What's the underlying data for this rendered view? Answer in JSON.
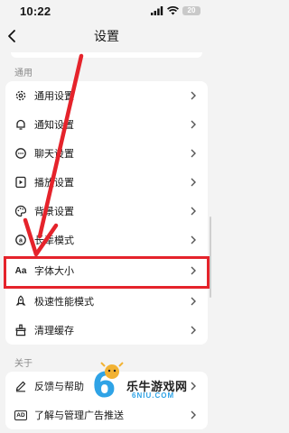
{
  "status_bar": {
    "time": "10:22",
    "battery": "20"
  },
  "header": {
    "title": "设置"
  },
  "sections": [
    {
      "label": "通用",
      "items": [
        {
          "label": "通用设置",
          "icon": "gear-icon"
        },
        {
          "label": "通知设置",
          "icon": "bell-icon"
        },
        {
          "label": "聊天设置",
          "icon": "chat-bubble-icon"
        },
        {
          "label": "播放设置",
          "icon": "play-icon"
        },
        {
          "label": "背景设置",
          "icon": "palette-icon"
        },
        {
          "label": "长辈模式",
          "icon": "elder-mode-icon"
        },
        {
          "label": "字体大小",
          "icon": "font-size-icon",
          "icon_text": "Aa"
        },
        {
          "label": "极速性能模式",
          "icon": "rocket-icon"
        },
        {
          "label": "清理缓存",
          "icon": "broom-icon"
        }
      ]
    },
    {
      "label": "关于",
      "items": [
        {
          "label": "反馈与帮助",
          "icon": "edit-icon"
        },
        {
          "label": "了解与管理广告推送",
          "icon": "ad-icon",
          "icon_text": "AD"
        }
      ]
    }
  ],
  "watermark": {
    "text": "乐牛游戏网",
    "url_text": "6NIU.COM"
  },
  "colors": {
    "highlight": "#e5232b",
    "background": "#f3f3f3",
    "card": "#ffffff"
  }
}
